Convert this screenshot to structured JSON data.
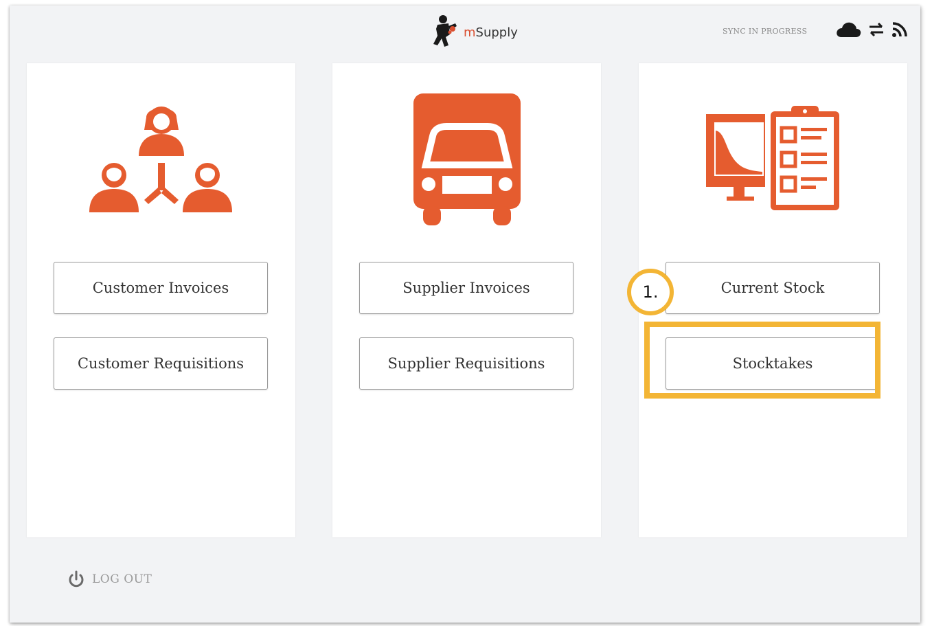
{
  "header": {
    "logo_prefix": "m",
    "logo_name": "Supply",
    "sync_status": "SYNC IN PROGRESS",
    "icons": [
      "mascot-icon",
      "cloud-icon",
      "sync-arrows-icon",
      "feed-icon"
    ]
  },
  "panels": [
    {
      "icon": "customers-network-icon",
      "buttons": [
        {
          "label": "Customer Invoices"
        },
        {
          "label": "Customer Requisitions"
        }
      ]
    },
    {
      "icon": "truck-icon",
      "buttons": [
        {
          "label": "Supplier Invoices"
        },
        {
          "label": "Supplier Requisitions"
        }
      ]
    },
    {
      "icon": "stock-clipboard-icon",
      "buttons": [
        {
          "label": "Current Stock"
        },
        {
          "label": "Stocktakes"
        }
      ]
    }
  ],
  "annotation": {
    "step_label": "1.",
    "highlight_color": "#f3b535"
  },
  "footer": {
    "logout_label": "LOG OUT",
    "logout_icon": "power-icon"
  },
  "colors": {
    "accent": "#e55c2f",
    "background": "#f2f3f5",
    "panel": "#ffffff"
  }
}
